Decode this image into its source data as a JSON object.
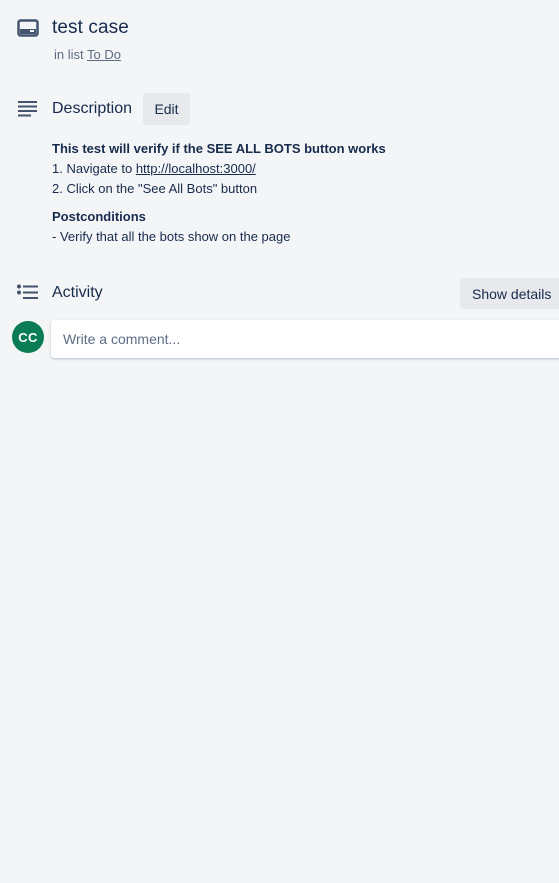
{
  "card": {
    "title": "test case",
    "in_list_prefix": "in list",
    "list_name": "To Do"
  },
  "description": {
    "heading": "Description",
    "edit_label": "Edit",
    "line1": "This test will verify if the SEE ALL BOTS button works",
    "line2_prefix": "1. Navigate to ",
    "line2_link": "http://localhost:3000/",
    "line3": "2. Click on the \"See All Bots\" button",
    "postconditions_heading": "Postconditions",
    "postconditions_line": "- Verify that all the bots show on the page"
  },
  "activity": {
    "heading": "Activity",
    "show_details_label": "Show details",
    "avatar_initials": "CC",
    "comment_placeholder": "Write a comment..."
  },
  "colors": {
    "background": "#f3f5f7",
    "text": "#172b4d",
    "muted_text": "#5e6c84",
    "button_bg": "#e7e9ed",
    "avatar_bg": "#0a7d55"
  }
}
